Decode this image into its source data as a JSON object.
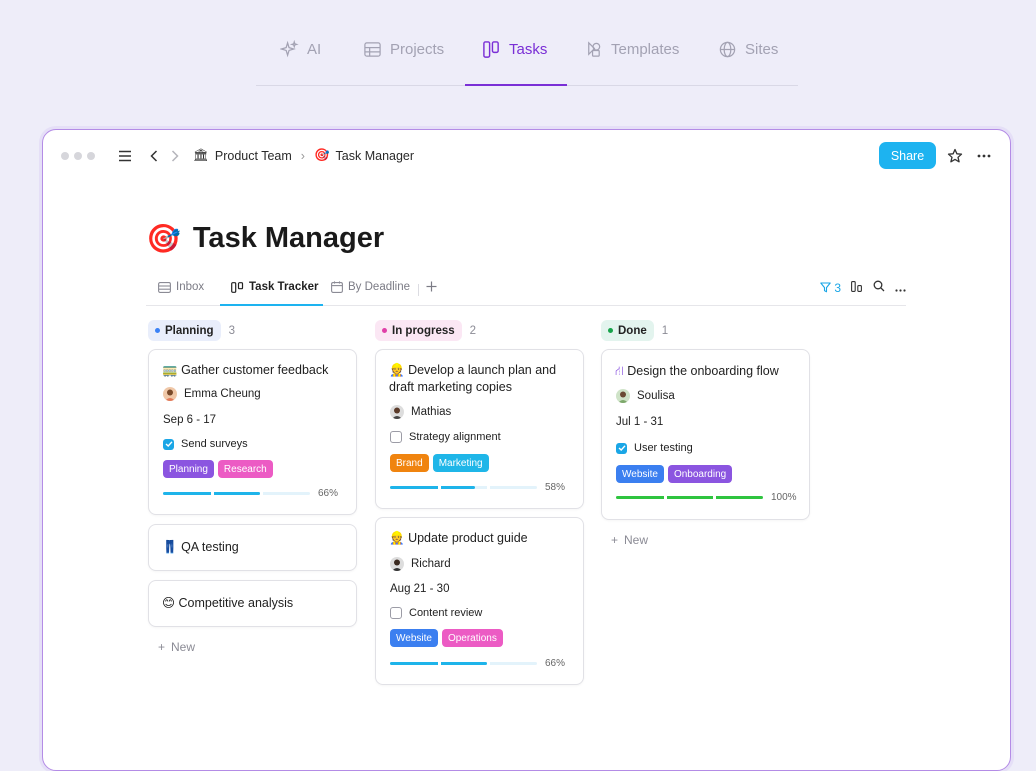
{
  "topnav": {
    "tabs": [
      {
        "label": "AI",
        "icon": "sparkle-icon"
      },
      {
        "label": "Projects",
        "icon": "table-icon"
      },
      {
        "label": "Tasks",
        "icon": "board-icon",
        "active": true
      },
      {
        "label": "Templates",
        "icon": "shapes-icon"
      },
      {
        "label": "Sites",
        "icon": "globe-icon"
      }
    ]
  },
  "window": {
    "breadcrumb": {
      "parent_emoji": "🏛",
      "parent": "Product Team",
      "current_emoji": "🎯",
      "current": "Task Manager"
    },
    "share_label": "Share",
    "page_title": "Task Manager",
    "page_emoji": "🎯"
  },
  "views": {
    "items": [
      {
        "label": "Inbox"
      },
      {
        "label": "Task Tracker",
        "active": true
      },
      {
        "label": "By Deadline"
      }
    ],
    "filter_count": "3"
  },
  "board": {
    "columns": [
      {
        "name": "Planning",
        "count": "3",
        "pill_bg": "#e9eefb",
        "dot": "#3b82f6",
        "new_label": "New",
        "cards": [
          {
            "emoji": "🚃",
            "title": "Gather customer feedback",
            "person": "Emma Cheung",
            "date": "Sep 6 - 17",
            "check": "Send surveys",
            "checked": true,
            "tags": [
              {
                "label": "Planning",
                "color": "#8b55e0"
              },
              {
                "label": "Research",
                "color": "#ec5bc4"
              }
            ],
            "progress": 0.66,
            "pct": "66%",
            "bar_color": "#1eb4ea"
          },
          {
            "emoji": "👖",
            "title": "QA testing"
          },
          {
            "emoji": "😊",
            "title": "Competitive analysis"
          }
        ]
      },
      {
        "name": "In progress",
        "count": "2",
        "pill_bg": "#fbe7f4",
        "dot": "#e040a8",
        "cards": [
          {
            "emoji": "👷",
            "title": "Develop a launch plan and draft marketing copies",
            "person": "Mathias",
            "check": "Strategy alignment",
            "checked": false,
            "tags": [
              {
                "label": "Brand",
                "color": "#f0840f"
              },
              {
                "label": "Marketing",
                "color": "#1fb6e8"
              }
            ],
            "progress": 0.58,
            "pct": "58%",
            "bar_color": "#1eb4ea"
          },
          {
            "emoji": "👷",
            "title": "Update product guide",
            "person": "Richard",
            "date": "Aug 21 - 30",
            "check": "Content review",
            "checked": false,
            "tags": [
              {
                "label": "Website",
                "color": "#3b7ff0"
              },
              {
                "label": "Operations",
                "color": "#ec5bc4"
              }
            ],
            "progress": 0.66,
            "pct": "66%",
            "bar_color": "#1eb4ea"
          }
        ]
      },
      {
        "name": "Done",
        "count": "1",
        "pill_bg": "#e3f4ee",
        "dot": "#16a34a",
        "new_label": "New",
        "cards": [
          {
            "emoji": "⛙",
            "title": "Design the onboarding flow",
            "person": "Soulisa",
            "date": "Jul 1 - 31",
            "check": "User testing",
            "checked": true,
            "tags": [
              {
                "label": "Website",
                "color": "#3b7ff0"
              },
              {
                "label": "Onboarding",
                "color": "#8b55e0"
              }
            ],
            "progress": 1.0,
            "pct": "100%",
            "bar_color": "#2fc43f"
          }
        ]
      }
    ]
  },
  "colors": {
    "accent_purple": "#7a2fd6",
    "accent_blue": "#1db3f0"
  }
}
